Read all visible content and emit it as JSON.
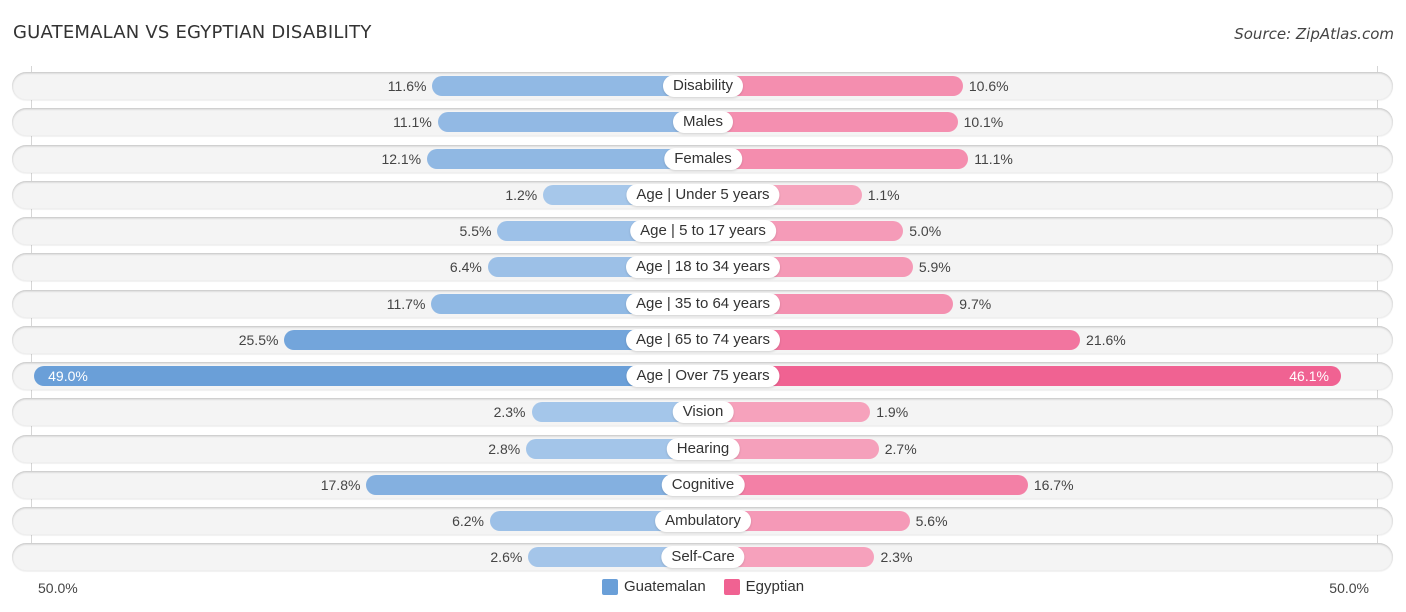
{
  "header": {
    "title": "GUATEMALAN VS EGYPTIAN DISABILITY",
    "source": "Source: ZipAtlas.com"
  },
  "colors": {
    "guatemalan": "#6a9fd8",
    "guatemalan_light": "#a9c9eb",
    "egyptian": "#f06292",
    "egyptian_light": "#f6a6bf"
  },
  "chart_data": {
    "type": "bar",
    "orientation": "horizontal-diverging",
    "title": "GUATEMALAN VS EGYPTIAN DISABILITY",
    "categories": [
      "Disability",
      "Males",
      "Females",
      "Age | Under 5 years",
      "Age | 5 to 17 years",
      "Age | 18 to 34 years",
      "Age | 35 to 64 years",
      "Age | 65 to 74 years",
      "Age | Over 75 years",
      "Vision",
      "Hearing",
      "Cognitive",
      "Ambulatory",
      "Self-Care"
    ],
    "series": [
      {
        "name": "Guatemalan",
        "values": [
          11.6,
          11.1,
          12.1,
          1.2,
          5.5,
          6.4,
          11.7,
          25.5,
          49.0,
          2.3,
          2.8,
          17.8,
          6.2,
          2.6
        ],
        "labels": [
          "11.6%",
          "11.1%",
          "12.1%",
          "1.2%",
          "5.5%",
          "6.4%",
          "11.7%",
          "25.5%",
          "49.0%",
          "2.3%",
          "2.8%",
          "17.8%",
          "6.2%",
          "2.6%"
        ]
      },
      {
        "name": "Egyptian",
        "values": [
          10.6,
          10.1,
          11.1,
          1.1,
          5.0,
          5.9,
          9.7,
          21.6,
          46.1,
          1.9,
          2.7,
          16.7,
          5.6,
          2.3
        ],
        "labels": [
          "10.6%",
          "10.1%",
          "11.1%",
          "1.1%",
          "5.0%",
          "5.9%",
          "9.7%",
          "21.6%",
          "46.1%",
          "1.9%",
          "2.7%",
          "16.7%",
          "5.6%",
          "2.3%"
        ]
      }
    ],
    "xlim": [
      -50,
      50
    ],
    "axis_labels": {
      "left": "50.0%",
      "right": "50.0%"
    },
    "legend": {
      "position": "bottom-center",
      "entries": [
        "Guatemalan",
        "Egyptian"
      ]
    },
    "grid": false
  }
}
